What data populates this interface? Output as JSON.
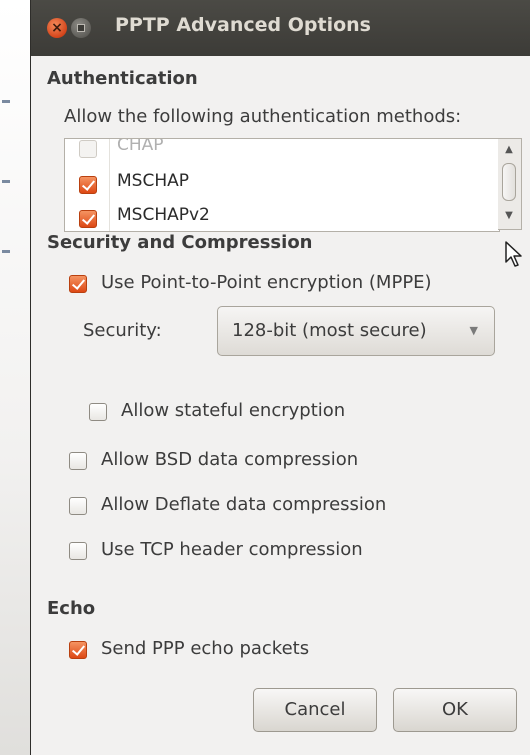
{
  "window": {
    "title": "PPTP Advanced Options"
  },
  "authentication": {
    "heading": "Authentication",
    "description": "Allow the following authentication methods:",
    "methods": [
      {
        "label": "CHAP",
        "checked": false,
        "enabled": false
      },
      {
        "label": "MSCHAP",
        "checked": true,
        "enabled": true
      },
      {
        "label": "MSCHAPv2",
        "checked": true,
        "enabled": true
      }
    ]
  },
  "security": {
    "heading": "Security and Compression",
    "use_mppe": {
      "label": "Use Point-to-Point encryption (MPPE)",
      "checked": true
    },
    "security_label": "Security:",
    "security_value": "128-bit (most secure)",
    "stateful": {
      "label": "Allow stateful encryption",
      "checked": false
    },
    "bsd": {
      "label": "Allow BSD data compression",
      "checked": false
    },
    "deflate": {
      "label": "Allow Deflate data compression",
      "checked": false
    },
    "tcp_header": {
      "label": "Use TCP header compression",
      "checked": false
    }
  },
  "echo": {
    "heading": "Echo",
    "send_echo": {
      "label": "Send PPP echo packets",
      "checked": true
    }
  },
  "buttons": {
    "cancel": "Cancel",
    "ok": "OK"
  },
  "colors": {
    "accent": "#dd4814",
    "titlebar": "#3c3b37",
    "background": "#f2f1f0"
  },
  "icons": [
    "close-icon",
    "minimize-icon",
    "checkbox-checked-icon",
    "dropdown-arrow-icon",
    "mouse-pointer-icon"
  ]
}
